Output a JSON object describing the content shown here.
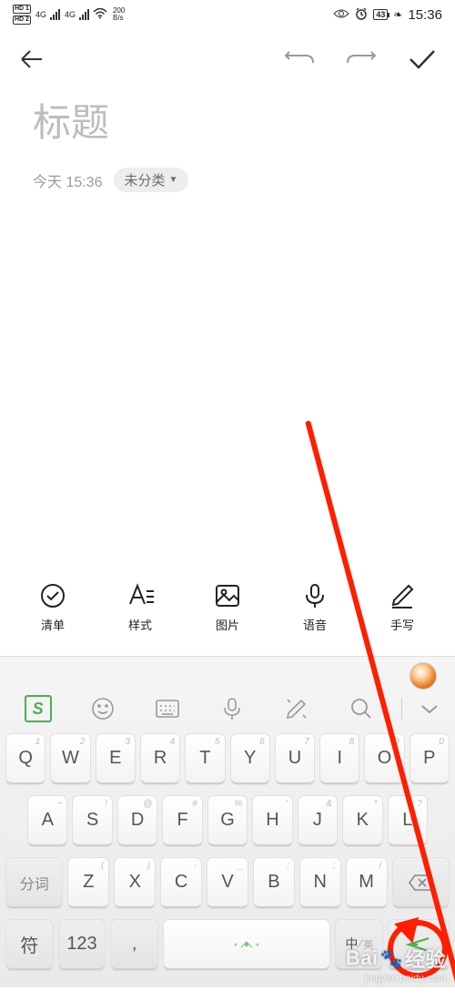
{
  "status": {
    "hd1": "HD 1",
    "hd2": "HD 2",
    "net1": "4G",
    "net2": "4G",
    "speed_num": "200",
    "speed_unit": "B/s",
    "battery": "43",
    "time": "15:36"
  },
  "header": {
    "undo_aria": "撤销",
    "redo_aria": "重做",
    "confirm_aria": "确认"
  },
  "note": {
    "title_placeholder": "标题",
    "date_text": "今天 15:36",
    "category_label": "未分类"
  },
  "tools": [
    {
      "id": "checklist",
      "label": "清单"
    },
    {
      "id": "style",
      "label": "样式"
    },
    {
      "id": "image",
      "label": "图片"
    },
    {
      "id": "voice",
      "label": "语音"
    },
    {
      "id": "handwrite",
      "label": "手写"
    }
  ],
  "keyboard": {
    "logo": "S",
    "row1": [
      {
        "main": "Q",
        "sup": "1"
      },
      {
        "main": "W",
        "sup": "2"
      },
      {
        "main": "E",
        "sup": "3"
      },
      {
        "main": "R",
        "sup": "4"
      },
      {
        "main": "T",
        "sup": "5"
      },
      {
        "main": "Y",
        "sup": "6"
      },
      {
        "main": "U",
        "sup": "7"
      },
      {
        "main": "I",
        "sup": "8"
      },
      {
        "main": "O",
        "sup": "9"
      },
      {
        "main": "P",
        "sup": "0"
      }
    ],
    "row2": [
      {
        "main": "A",
        "sup": "~"
      },
      {
        "main": "S",
        "sup": "!"
      },
      {
        "main": "D",
        "sup": "@"
      },
      {
        "main": "F",
        "sup": "#"
      },
      {
        "main": "G",
        "sup": "%"
      },
      {
        "main": "H",
        "sup": "'"
      },
      {
        "main": "J",
        "sup": "&"
      },
      {
        "main": "K",
        "sup": "*"
      },
      {
        "main": "L",
        "sup": "?"
      }
    ],
    "row3_left": "分词",
    "row3": [
      {
        "main": "Z",
        "sup": "("
      },
      {
        "main": "X",
        "sup": ")"
      },
      {
        "main": "C",
        "sup": "-"
      },
      {
        "main": "V",
        "sup": "_"
      },
      {
        "main": "B",
        "sup": ":"
      },
      {
        "main": "N",
        "sup": ";"
      },
      {
        "main": "M",
        "sup": "/"
      }
    ],
    "row3_right": "⌫",
    "row4": {
      "sym": "符",
      "num": "123",
      "comma": ",",
      "lang_cn": "中",
      "lang_en": "英",
      "enter": "⋖"
    }
  },
  "watermark": {
    "brand_a": "Bai",
    "brand_b": "经验",
    "url": "jingyan.baidu.com"
  }
}
